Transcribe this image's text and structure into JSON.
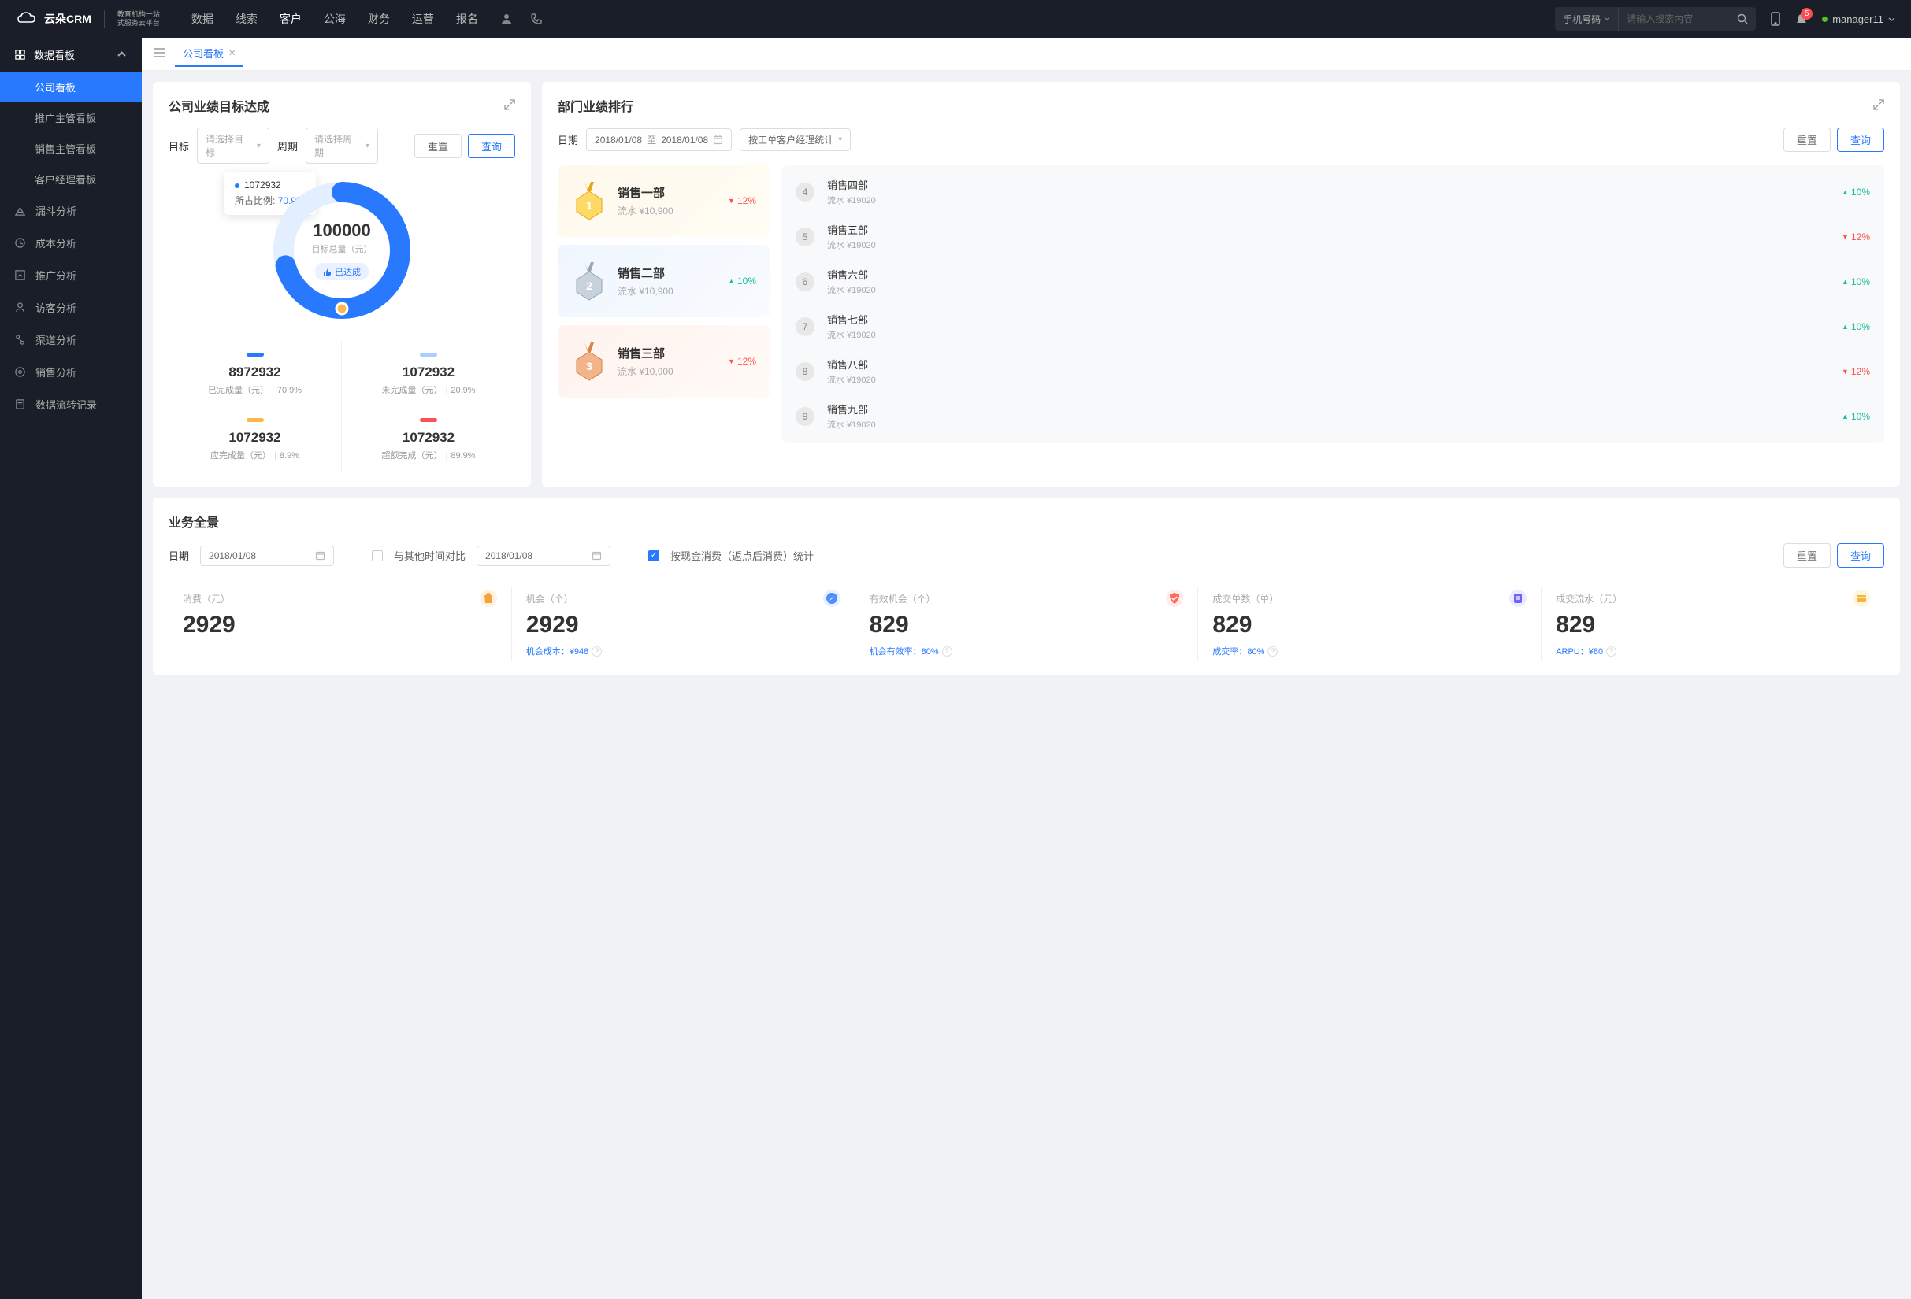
{
  "topnav": {
    "logo_main": "云朵CRM",
    "logo_sub1": "教育机构一站",
    "logo_sub2": "式服务云平台",
    "menu": [
      "数据",
      "线索",
      "客户",
      "公海",
      "财务",
      "运营",
      "报名"
    ],
    "active_menu": 2,
    "search_type": "手机号码",
    "search_placeholder": "请输入搜索内容",
    "badge": "5",
    "user": "manager11"
  },
  "sidebar": {
    "group_title": "数据看板",
    "subs": [
      "公司看板",
      "推广主管看板",
      "销售主管看板",
      "客户经理看板"
    ],
    "active_sub": 0,
    "items": [
      {
        "label": "漏斗分析"
      },
      {
        "label": "成本分析"
      },
      {
        "label": "推广分析"
      },
      {
        "label": "访客分析"
      },
      {
        "label": "渠道分析"
      },
      {
        "label": "销售分析"
      },
      {
        "label": "数据流转记录"
      }
    ]
  },
  "tabs": {
    "current": "公司看板"
  },
  "goal": {
    "title": "公司业绩目标达成",
    "target_label": "目标",
    "target_ph": "请选择目标",
    "period_label": "周期",
    "period_ph": "请选择周期",
    "reset": "重置",
    "query": "查询",
    "tooltip_val": "1072932",
    "tooltip_lbl": "所占比例:",
    "tooltip_pct": "70.9%",
    "center_val": "100000",
    "center_sub": "目标总量（元）",
    "center_badge": "已达成",
    "metrics": [
      {
        "value": "8972932",
        "label": "已完成量（元）",
        "pct": "70.9%",
        "color": "blue"
      },
      {
        "value": "1072932",
        "label": "未完成量（元）",
        "pct": "20.9%",
        "color": "lblue"
      },
      {
        "value": "1072932",
        "label": "应完成量（元）",
        "pct": "8.9%",
        "color": "orange"
      },
      {
        "value": "1072932",
        "label": "超额完成（元）",
        "pct": "89.9%",
        "color": "red"
      }
    ]
  },
  "rank": {
    "title": "部门业绩排行",
    "date_label": "日期",
    "date_from": "2018/01/08",
    "date_sep": "至",
    "date_to": "2018/01/08",
    "mode": "按工单客户经理统计",
    "reset": "重置",
    "query": "查询",
    "top3": [
      {
        "name": "销售一部",
        "amount": "流水 ¥10,900",
        "pct": "12%",
        "dir": "down"
      },
      {
        "name": "销售二部",
        "amount": "流水 ¥10,900",
        "pct": "10%",
        "dir": "up"
      },
      {
        "name": "销售三部",
        "amount": "流水 ¥10,900",
        "pct": "12%",
        "dir": "down"
      }
    ],
    "rest": [
      {
        "n": "4",
        "name": "销售四部",
        "amount": "流水 ¥19020",
        "pct": "10%",
        "dir": "up"
      },
      {
        "n": "5",
        "name": "销售五部",
        "amount": "流水 ¥19020",
        "pct": "12%",
        "dir": "down"
      },
      {
        "n": "6",
        "name": "销售六部",
        "amount": "流水 ¥19020",
        "pct": "10%",
        "dir": "up"
      },
      {
        "n": "7",
        "name": "销售七部",
        "amount": "流水 ¥19020",
        "pct": "10%",
        "dir": "up"
      },
      {
        "n": "8",
        "name": "销售八部",
        "amount": "流水 ¥19020",
        "pct": "12%",
        "dir": "down"
      },
      {
        "n": "9",
        "name": "销售九部",
        "amount": "流水 ¥19020",
        "pct": "10%",
        "dir": "up"
      }
    ]
  },
  "overview": {
    "title": "业务全景",
    "date_label": "日期",
    "date1": "2018/01/08",
    "compare_label": "与其他时间对比",
    "date2": "2018/01/08",
    "cash_label": "按现金消费（返点后消费）统计",
    "reset": "重置",
    "query": "查询",
    "stats": [
      {
        "label": "消费（元）",
        "value": "2929",
        "sub": "",
        "icon": "or",
        "glyph": "bag"
      },
      {
        "label": "机会（个）",
        "value": "2929",
        "sub": "机会成本：¥948",
        "icon": "bl",
        "glyph": "nav"
      },
      {
        "label": "有效机会（个）",
        "value": "829",
        "sub": "机会有效率：80%",
        "icon": "rd",
        "glyph": "shield"
      },
      {
        "label": "成交单数（单）",
        "value": "829",
        "sub": "成交率：80%",
        "icon": "pu",
        "glyph": "doc"
      },
      {
        "label": "成交流水（元）",
        "value": "829",
        "sub": "ARPU：¥80",
        "icon": "yl",
        "glyph": "card"
      }
    ]
  },
  "chart_data": {
    "type": "pie",
    "title": "目标总量（元）",
    "total": 100000,
    "series": [
      {
        "name": "已完成量",
        "value": 8972932,
        "pct": 70.9,
        "color": "#2979ff"
      },
      {
        "name": "未完成量",
        "value": 1072932,
        "pct": 20.9,
        "color": "#a8cfff"
      }
    ]
  }
}
